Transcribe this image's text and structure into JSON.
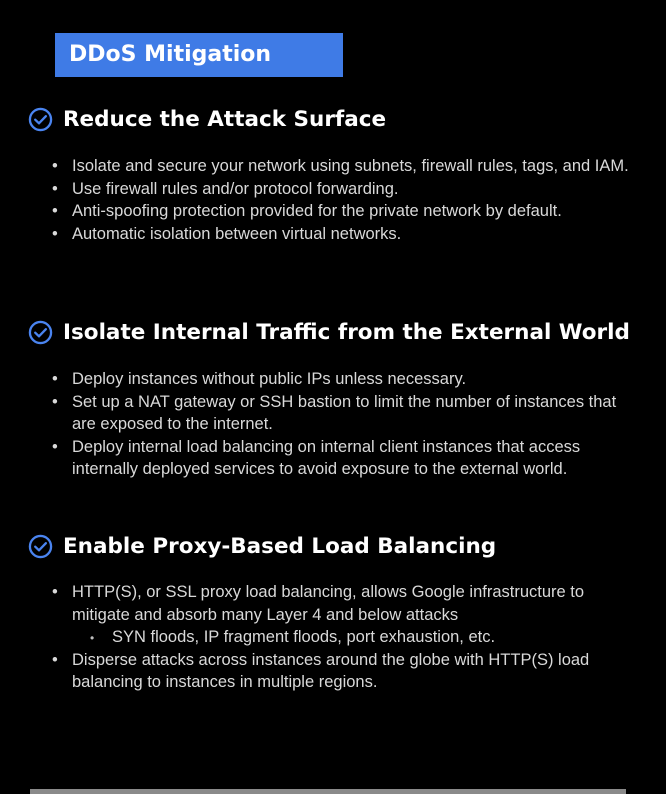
{
  "header": {
    "title": "DDoS Mitigation"
  },
  "colors": {
    "accent": "#3f7be6",
    "background": "#000000"
  },
  "sections": [
    {
      "icon": "check-circle-icon",
      "title": "Reduce the Attack Surface",
      "bullets": [
        "Isolate and secure your network using subnets, firewall rules, tags, and IAM.",
        "Use firewall rules and/or protocol forwarding.",
        "Anti-spoofing protection provided for the private network by default.",
        "Automatic isolation between virtual networks."
      ]
    },
    {
      "icon": "check-circle-icon",
      "title": "Isolate Internal Traffic from the External World",
      "bullets": [
        "Deploy instances without public IPs unless necessary.",
        "Set up a NAT gateway or SSH bastion to limit the number of instances that are exposed to the internet.",
        "Deploy internal load balancing on internal client instances that access internally deployed services to avoid exposure to the external world."
      ]
    },
    {
      "icon": "check-circle-icon",
      "title": "Enable Proxy-Based Load Balancing",
      "bullets": [
        "HTTP(S), or SSL proxy load balancing, allows Google infrastructure to mitigate and absorb many Layer 4 and below attacks",
        "Disperse attacks across instances around the globe with HTTP(S) load balancing to instances in multiple regions."
      ],
      "sub_bullets": [
        "SYN floods, IP fragment floods, port exhaustion, etc."
      ]
    }
  ]
}
